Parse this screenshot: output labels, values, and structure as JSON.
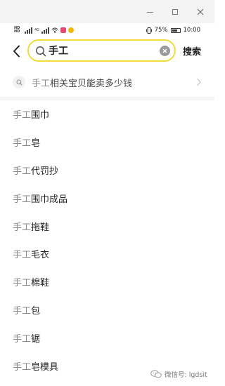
{
  "window": {
    "controls": [
      "minimize",
      "maximize",
      "close"
    ]
  },
  "status_bar": {
    "sim_labels": [
      "HD",
      "HD"
    ],
    "network": "4G",
    "battery": "75%",
    "battery_level": 0.75,
    "time": "10:00"
  },
  "search": {
    "query": "手工",
    "button_label": "搜索",
    "accent_color": "#f0dc3a"
  },
  "top_suggestion": {
    "highlight": "手工",
    "rest": "相关宝贝能卖多少钱"
  },
  "suggestions": [
    {
      "highlight": "手工",
      "rest": "围巾"
    },
    {
      "highlight": "手工",
      "rest": "皂"
    },
    {
      "highlight": "手工",
      "rest": "代罚抄"
    },
    {
      "highlight": "手工",
      "rest": "围巾成品"
    },
    {
      "highlight": "手工",
      "rest": "拖鞋"
    },
    {
      "highlight": "手工",
      "rest": "毛衣"
    },
    {
      "highlight": "手工",
      "rest": "棉鞋"
    },
    {
      "highlight": "手工",
      "rest": "包"
    },
    {
      "highlight": "手工",
      "rest": "锯"
    },
    {
      "highlight": "手工",
      "rest": "皂模具"
    }
  ],
  "watermark": {
    "text": "微信号: lgdsit"
  }
}
